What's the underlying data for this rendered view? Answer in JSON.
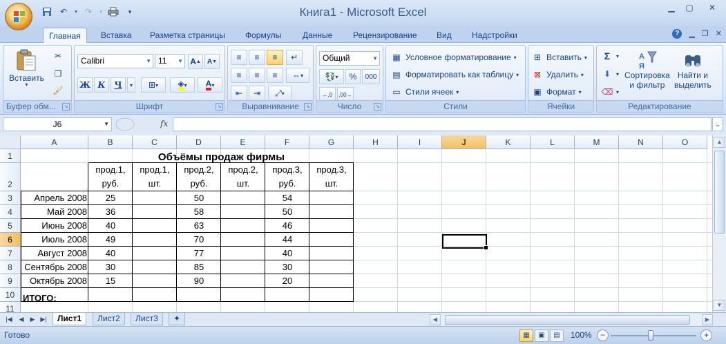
{
  "window": {
    "title": "Книга1 - Microsoft Excel"
  },
  "tabs": [
    "Главная",
    "Вставка",
    "Разметка страницы",
    "Формулы",
    "Данные",
    "Рецензирование",
    "Вид",
    "Надстройки"
  ],
  "ribbon": {
    "clipboard": {
      "label": "Буфер обм...",
      "paste": "Вставить"
    },
    "font": {
      "label": "Шрифт",
      "name": "Calibri",
      "size": "11",
      "bold": "Ж",
      "italic": "К",
      "underline": "Ч"
    },
    "alignment": {
      "label": "Выравнивание"
    },
    "number": {
      "label": "Число",
      "format": "Общий",
      "percent": "%",
      "thousands": "000"
    },
    "styles": {
      "label": "Стили",
      "conditional": "Условное форматирование",
      "as_table": "Форматировать как таблицу",
      "cell_styles": "Стили ячеек"
    },
    "cells": {
      "label": "Ячейки",
      "insert": "Вставить",
      "delete": "Удалить",
      "format": "Формат"
    },
    "editing": {
      "label": "Редактирование",
      "sort_line1": "Сортировка",
      "sort_line2": "и фильтр",
      "find_line1": "Найти и",
      "find_line2": "выделить",
      "sigma": "Σ"
    }
  },
  "formula_bar": {
    "name_box": "J6",
    "fx": "fx",
    "value": ""
  },
  "columns": [
    "A",
    "B",
    "C",
    "D",
    "E",
    "F",
    "G",
    "H",
    "I",
    "J",
    "K",
    "L",
    "M",
    "N",
    "O"
  ],
  "rows": [
    "1",
    "2",
    "3",
    "4",
    "5",
    "6",
    "7",
    "8",
    "9",
    "10",
    "11"
  ],
  "sheet": {
    "title": "Объёмы продаж фирмы",
    "headers": [
      [
        "прод.1,",
        "руб."
      ],
      [
        "прод.1,",
        "шт."
      ],
      [
        "прод.2,",
        "руб."
      ],
      [
        "прод.2,",
        "шт."
      ],
      [
        "прод.3,",
        "руб."
      ],
      [
        "прод.3,",
        "шт."
      ]
    ],
    "data": [
      {
        "month": "Апрель 2008",
        "b": "25",
        "d": "50",
        "f": "54"
      },
      {
        "month": "Май 2008",
        "b": "36",
        "d": "58",
        "f": "50"
      },
      {
        "month": "Июнь 2008",
        "b": "40",
        "d": "63",
        "f": "46"
      },
      {
        "month": "Июль 2008",
        "b": "49",
        "d": "70",
        "f": "44"
      },
      {
        "month": "Август 2008",
        "b": "40",
        "d": "77",
        "f": "40"
      },
      {
        "month": "Сентябрь 2008",
        "b": "30",
        "d": "85",
        "f": "30"
      },
      {
        "month": "Октябрь 2008",
        "b": "15",
        "d": "90",
        "f": "20"
      }
    ],
    "total_label": "ИТОГО:"
  },
  "sheet_tabs": [
    "Лист1",
    "Лист2",
    "Лист3"
  ],
  "status": {
    "text": "Готово",
    "zoom": "100%"
  }
}
